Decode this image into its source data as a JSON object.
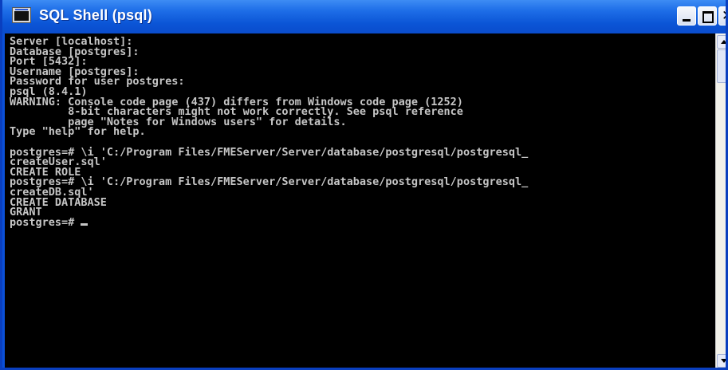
{
  "window": {
    "title": "SQL Shell (psql)",
    "icon": "console-window-icon"
  },
  "colors": {
    "titlebar": "#0a55d6",
    "console_background": "#000000",
    "console_text": "#c6c6c6"
  },
  "console": {
    "lines": [
      "Server [localhost]:",
      "Database [postgres]:",
      "Port [5432]:",
      "Username [postgres]:",
      "Password for user postgres:",
      "psql (8.4.1)",
      "WARNING: Console code page (437) differs from Windows code page (1252)",
      "         8-bit characters might not work correctly. See psql reference",
      "         page \"Notes for Windows users\" for details.",
      "Type \"help\" for help.",
      "",
      "postgres=# \\i 'C:/Program Files/FMEServer/Server/database/postgresql/postgresql_",
      "createUser.sql'",
      "CREATE ROLE",
      "postgres=# \\i 'C:/Program Files/FMEServer/Server/database/postgresql/postgresql_",
      "createDB.sql'",
      "CREATE DATABASE",
      "GRANT"
    ],
    "prompt": "postgres=# "
  }
}
